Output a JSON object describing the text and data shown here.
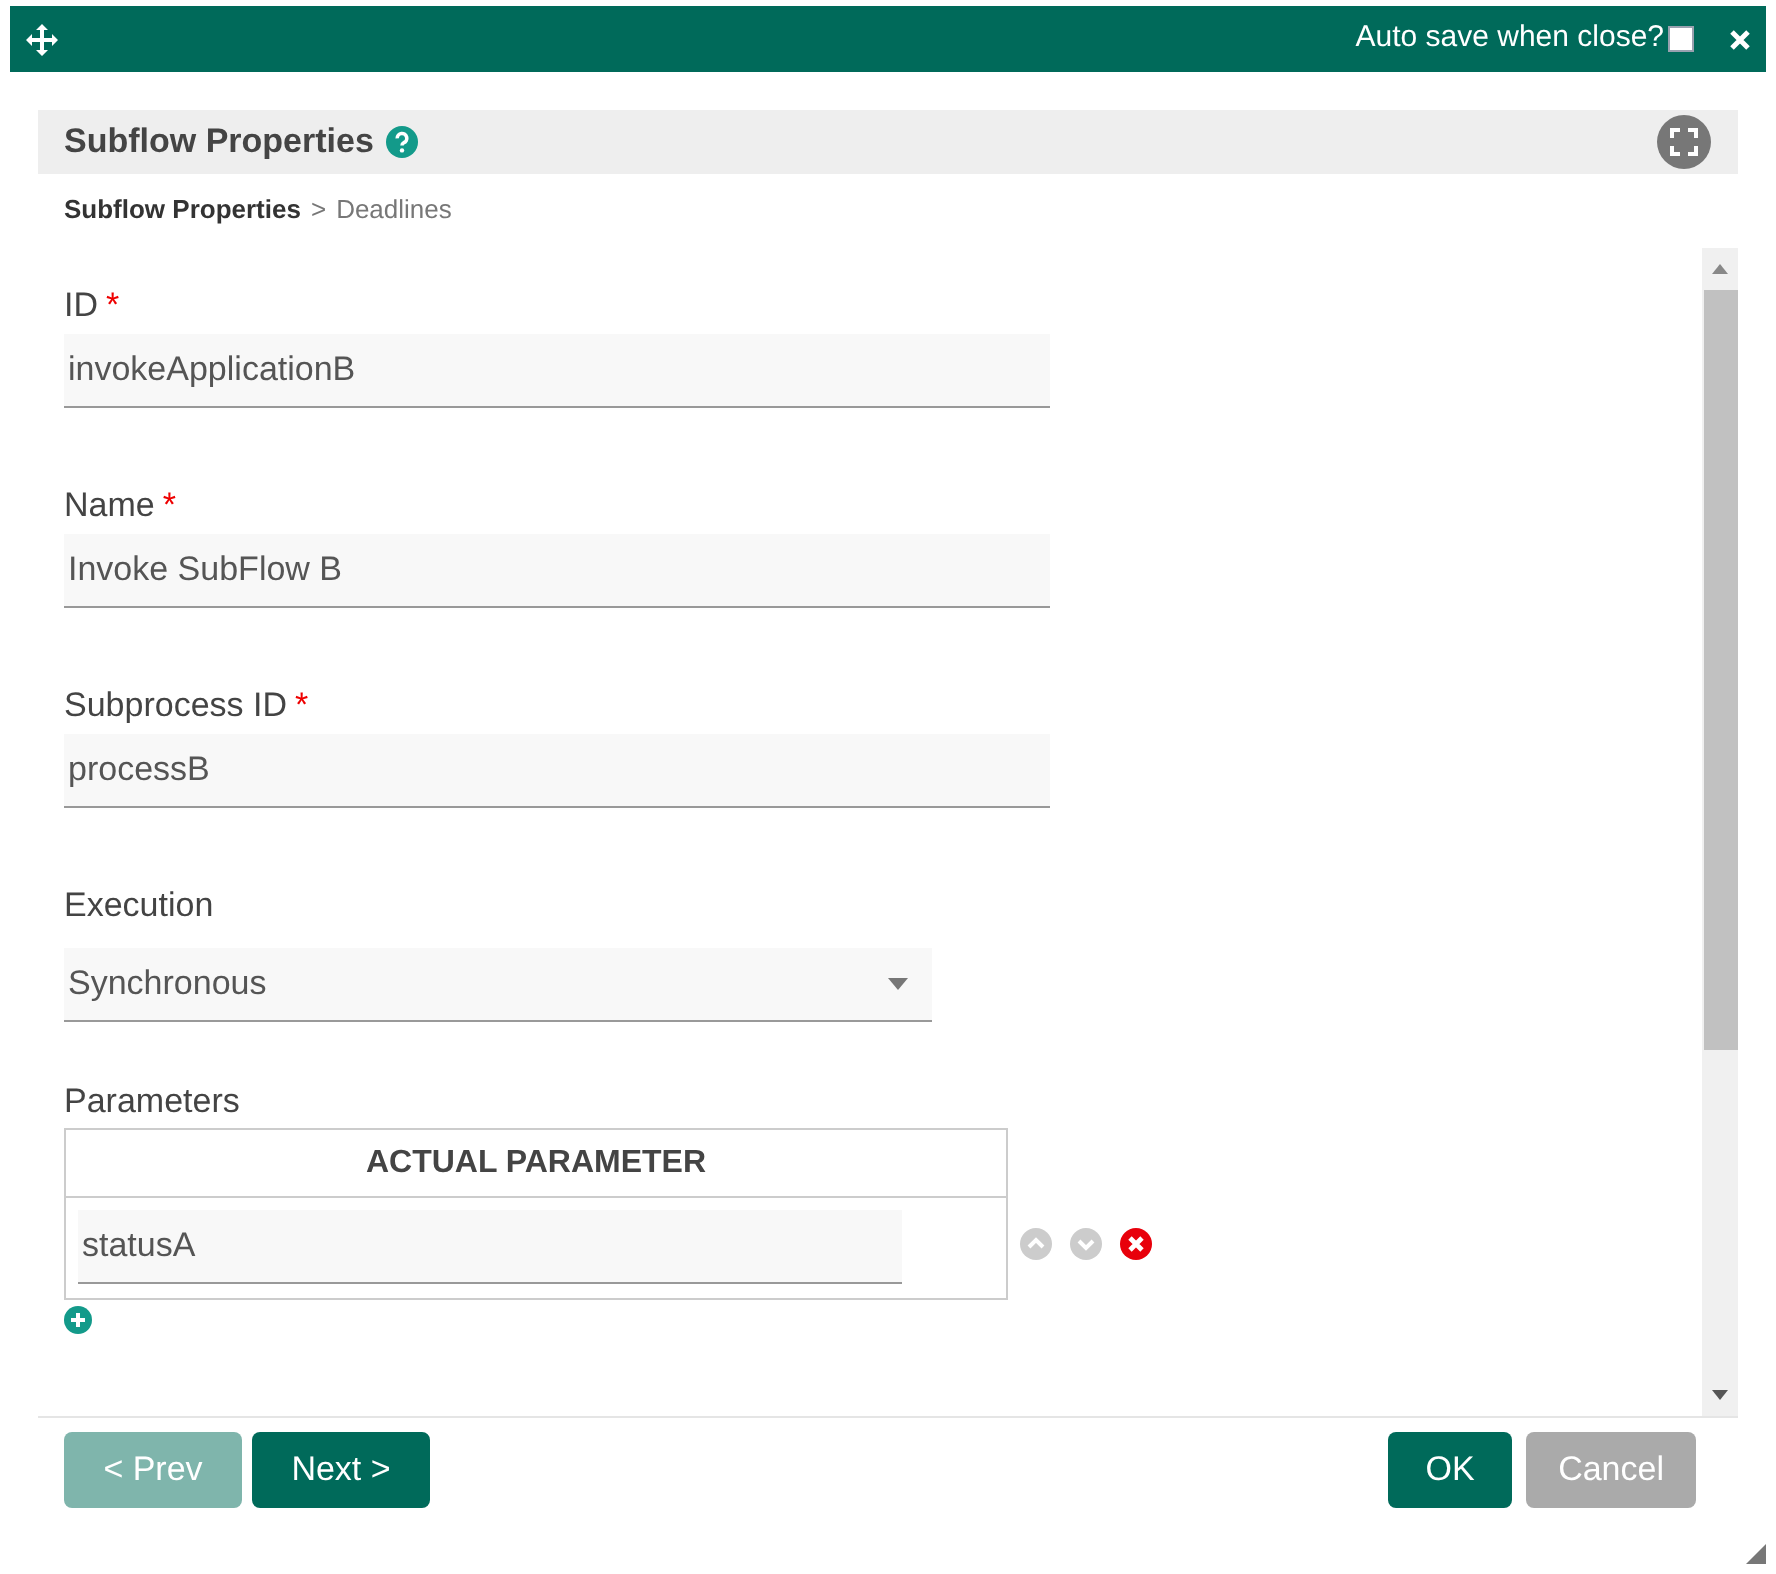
{
  "window": {
    "auto_save": {
      "label": "Auto save when close?",
      "checked": false
    }
  },
  "panel": {
    "title": "Subflow Properties"
  },
  "breadcrumb": [
    {
      "label": "Subflow Properties",
      "selected": true
    },
    {
      "label": "Deadlines",
      "selected": false
    }
  ],
  "breadcrumb_separator": ">",
  "fields": [
    {
      "kind": "text",
      "label": "ID",
      "required_mark": "*",
      "value": "invokeApplicationB"
    },
    {
      "kind": "text",
      "label": "Name",
      "required_mark": "*",
      "value": "Invoke SubFlow B"
    },
    {
      "kind": "text",
      "label": "Subprocess ID",
      "required_mark": "*",
      "value": "processB"
    },
    {
      "kind": "select",
      "label": "Execution",
      "value": "Synchronous"
    }
  ],
  "parameters": {
    "label": "Parameters",
    "column": "ACTUAL PARAMETER",
    "rows": [
      {
        "value": "statusA"
      }
    ]
  },
  "buttons": [
    {
      "label": "< Prev",
      "kind": "nav",
      "disabled": true
    },
    {
      "label": "Next >",
      "kind": "nav",
      "disabled": false
    },
    {
      "label": "OK",
      "kind": "confirm",
      "disabled": false
    },
    {
      "label": "Cancel",
      "kind": "confirm",
      "disabled": true
    }
  ]
}
